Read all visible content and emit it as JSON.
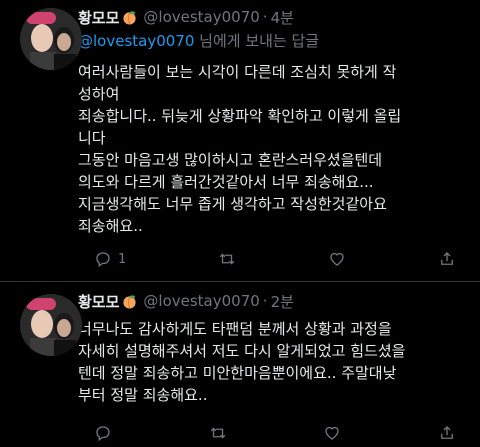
{
  "tweets": [
    {
      "name": "황모모",
      "handle": "@lovestay0070",
      "separator": "·",
      "time": "4분",
      "reply_mention": "@lovestay0070",
      "reply_suffix": " 님에게 보내는 답글",
      "lines": [
        "여러사람들이 보는 시각이 다른데 조심치 못하게 작",
        "성하여",
        "죄송합니다.. 뒤늦게 상황파악 확인하고 이렇게 올립",
        "니다",
        "그동안 마음고생 많이하시고 혼란스러우셨을텐데",
        "의도와 다르게 흘러간것같아서 너무 죄송해요...",
        "지금생각해도 너무 좁게 생각하고 작성한것같아요",
        "죄송해요.."
      ],
      "reply_count": "1"
    },
    {
      "name": "황모모",
      "handle": "@lovestay0070",
      "separator": "·",
      "time": "2분",
      "lines": [
        "너무나도 감사하게도 타팬덤 분께서 상황과 과정을",
        "자세히 설명해주셔서 저도 다시 알게되었고 힘드셨을",
        "텐데 정말 죄송하고 미안한마음뿐이에요.. 주말대낮",
        "부터 정말 죄송해요.."
      ]
    }
  ],
  "icons": {
    "reply": "reply-icon",
    "retweet": "retweet-icon",
    "like": "like-icon",
    "share": "share-icon",
    "peach": "peach-emoji-icon"
  },
  "colors": {
    "background": "#000000",
    "text": "#e7e9ea",
    "muted": "#71767b",
    "link": "#1d9bf0"
  }
}
